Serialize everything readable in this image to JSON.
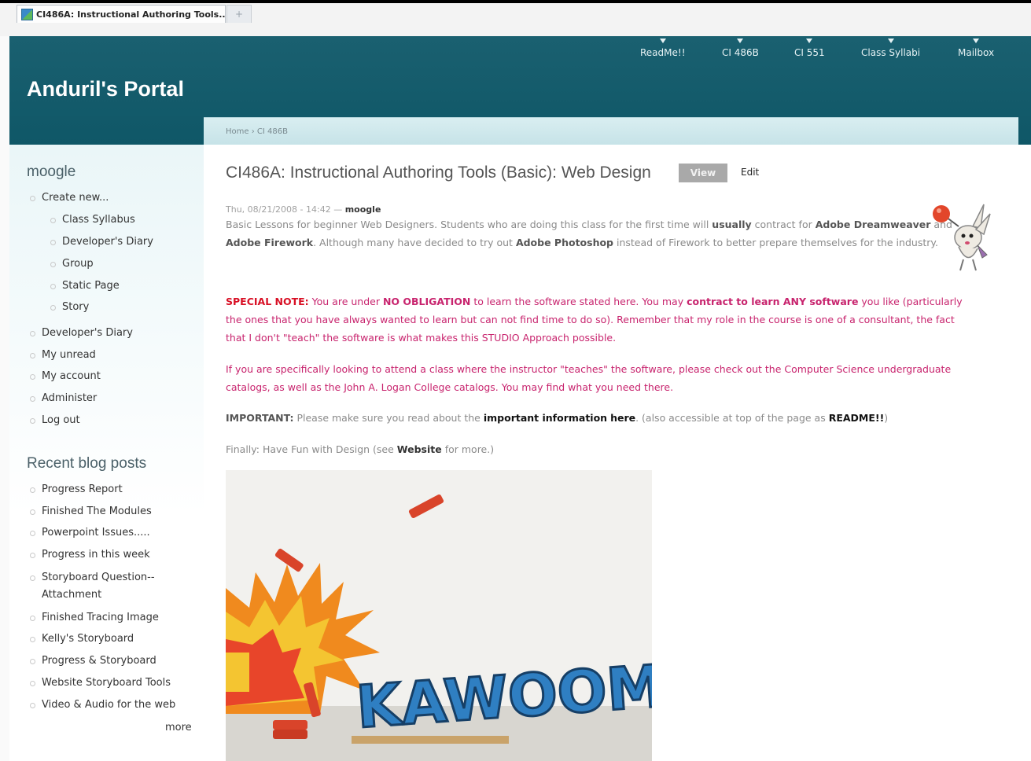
{
  "browser": {
    "tab_title": "CI486A: Instructional Authoring Tools...",
    "new_tab": "+"
  },
  "site": {
    "name": "Anduril's Portal",
    "nav": [
      "ReadMe!!",
      "CI 486B",
      "CI 551",
      "Class Syllabi",
      "Mailbox"
    ]
  },
  "breadcrumb": {
    "home": "Home",
    "separator": "›",
    "current": "CI 486B"
  },
  "sidebar": {
    "user_block": {
      "title": "moogle",
      "create_new": "Create new...",
      "create_items": [
        "Class Syllabus",
        "Developer's Diary",
        "Group",
        "Static Page",
        "Story"
      ],
      "items": [
        "Developer's Diary",
        "My unread",
        "My account",
        "Administer",
        "Log out"
      ]
    },
    "blog_block": {
      "title": "Recent blog posts",
      "items": [
        "Progress Report",
        "Finished The Modules",
        "Powerpoint Issues.....",
        "Progress in this week",
        "Storyboard Question--",
        "Attachment",
        "Finished Tracing Image",
        "Kelly's Storyboard",
        "Progress & Storyboard",
        "Website Storyboard Tools",
        "Video & Audio for the web"
      ],
      "more": "more"
    }
  },
  "node": {
    "title": "CI486A: Instructional Authoring Tools (Basic): Web Design",
    "view_label": "View",
    "edit_label": "Edit",
    "submitted": "Thu, 08/21/2008 - 14:42 —",
    "author": "moogle",
    "p1": {
      "a": "Basic Lessons for beginner Web Designers. Students who are doing this class for the first time will ",
      "b": "usually",
      "c": " contract for ",
      "d": "Adobe Dreamweaver",
      "e": " and ",
      "f": "Adobe Firework",
      "g": ". Although many have decided to try out ",
      "h": "Adobe Photoshop",
      "i": " instead of Firework to better prepare themselves for the industry."
    },
    "p2": {
      "label": "SPECIAL NOTE:",
      "a": " You are under ",
      "b": "NO OBLIGATION",
      "c": " to learn the software stated here. You may ",
      "d": "contract to learn ANY software",
      "e": " you like (particularly the ones that you have always wanted to learn but can not find time to do so). Remember that my role in the course is one of a consultant, the fact that I don't \"teach\" the software is what makes this STUDIO Approach possible."
    },
    "p3": "If you are specifically looking to attend a class where the instructor \"teaches\" the software, please check out the Computer Science undergraduate catalogs, as well as the John A. Logan College catalogs. You may find what you need there.",
    "p4": {
      "label": "IMPORTANT:",
      "a": " Please make sure you read about the ",
      "b": "important information",
      "c": " ",
      "d": "here",
      "e": ". (also accessible at top of the page as ",
      "f": "README!!",
      "g": ")"
    },
    "p5": {
      "a": "Finally: Have Fun with Design (see ",
      "b": "Website",
      "c": " for more.)"
    },
    "image_text": "KAWOOM!"
  },
  "colors": {
    "header_bg": "#1a6070",
    "accent_pink": "#c8246e",
    "accent_red": "#d80f24"
  }
}
